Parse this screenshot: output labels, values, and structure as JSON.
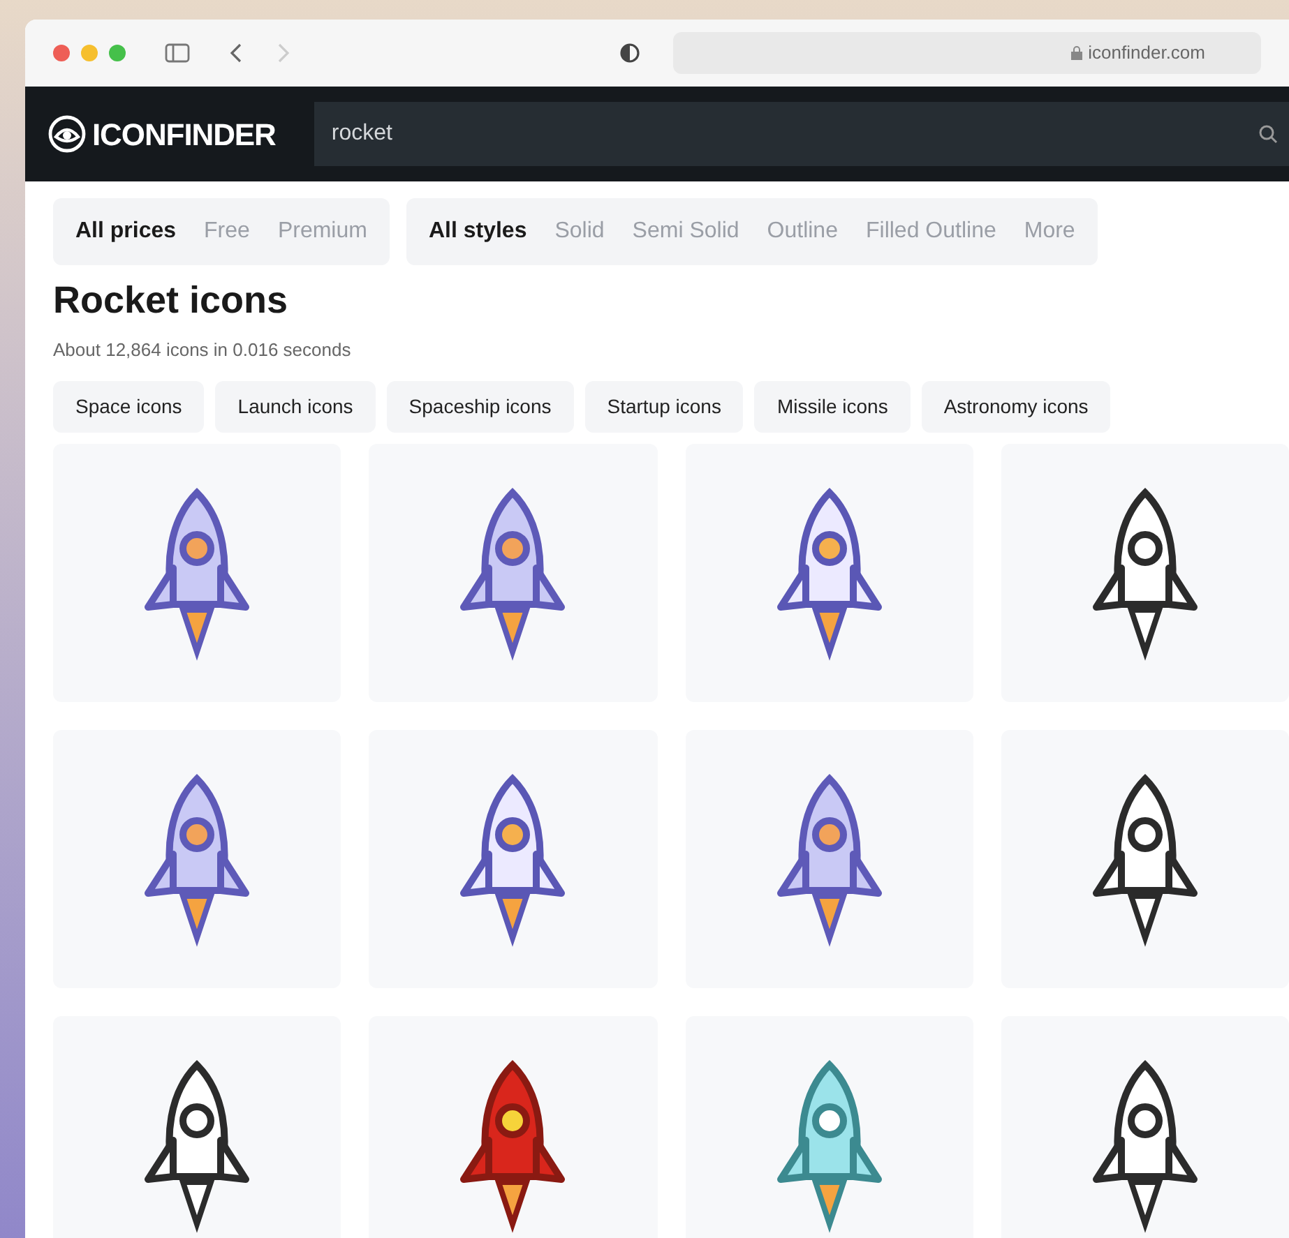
{
  "browser": {
    "address": "iconfinder.com"
  },
  "header": {
    "logo": "ICONFINDER",
    "search": {
      "value": "rocket"
    }
  },
  "price_filters": [
    {
      "label": "All prices",
      "selected": true
    },
    {
      "label": "Free",
      "selected": false
    },
    {
      "label": "Premium",
      "selected": false
    }
  ],
  "style_filters": [
    {
      "label": "All styles",
      "selected": true
    },
    {
      "label": "Solid",
      "selected": false
    },
    {
      "label": "Semi Solid",
      "selected": false
    },
    {
      "label": "Outline",
      "selected": false
    },
    {
      "label": "Filled Outline",
      "selected": false
    },
    {
      "label": "More",
      "selected": false
    }
  ],
  "title": "Rocket icons",
  "result_info": "About 12,864 icons in 0.016 seconds",
  "related_tags": [
    "Space icons",
    "Launch icons",
    "Spaceship icons",
    "Startup icons",
    "Missile icons",
    "Astronomy icons"
  ],
  "icons": [
    {
      "kind": "flat"
    },
    {
      "kind": "flat"
    },
    {
      "kind": "filled"
    },
    {
      "kind": "outline"
    },
    {
      "kind": "flat"
    },
    {
      "kind": "filled"
    },
    {
      "kind": "flat"
    },
    {
      "kind": "outline"
    },
    {
      "kind": "outline"
    },
    {
      "kind": "red"
    },
    {
      "kind": "cyan"
    },
    {
      "kind": "outline"
    }
  ]
}
